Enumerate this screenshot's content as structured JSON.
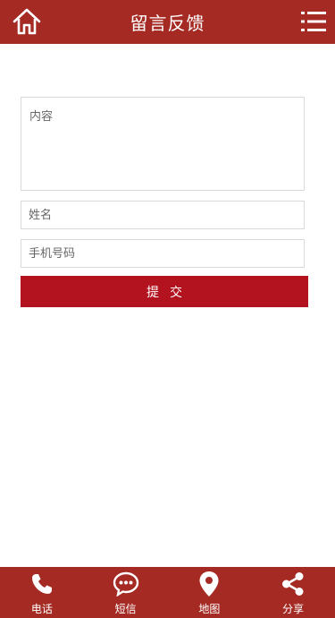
{
  "header": {
    "title": "留言反馈",
    "home_icon": "home-icon",
    "menu_icon": "menu-list-icon"
  },
  "form": {
    "content_placeholder": "内容",
    "name_placeholder": "姓名",
    "phone_placeholder": "手机号码",
    "submit_label": "提交"
  },
  "footer": {
    "items": [
      {
        "label": "电话",
        "icon": "phone-icon"
      },
      {
        "label": "短信",
        "icon": "message-bubble-icon"
      },
      {
        "label": "地图",
        "icon": "map-pin-icon"
      },
      {
        "label": "分享",
        "icon": "share-icon"
      }
    ]
  },
  "colors": {
    "bar": "#a52a23",
    "button": "#b3121f"
  }
}
